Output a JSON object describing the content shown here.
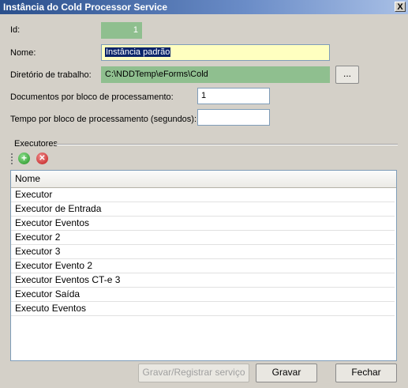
{
  "window": {
    "title": "Instância do Cold Processor Service",
    "close_label": "X"
  },
  "form": {
    "id_label": "Id:",
    "id_value": "1",
    "nome_label": "Nome:",
    "nome_value": "Instância padrão",
    "diretorio_label": "Diretório de trabalho:",
    "diretorio_value": "C:\\NDDTemp\\eForms\\Cold",
    "browse_label": "...",
    "docs_label": "Documentos por bloco de processamento:",
    "docs_value": "1",
    "tempo_label": "Tempo por bloco de processamento (segundos):",
    "tempo_value": ""
  },
  "executores": {
    "group_title": "Executores",
    "toolbar": {
      "add_icon": "add-icon",
      "remove_icon": "remove-icon"
    },
    "column_header": "Nome",
    "rows": [
      "Executor",
      "Executor de Entrada",
      "Executor Eventos",
      "Executor 2",
      "Executor 3",
      "Executor Evento 2",
      "Executor Eventos CT-e 3",
      "Executor Saída",
      "Executo Eventos"
    ]
  },
  "buttons": {
    "register_label": "Gravar/Registrar serviço",
    "save_label": "Gravar",
    "close_label": "Fechar"
  },
  "colors": {
    "titlebar_start": "#2a4f8c",
    "readonly_field": "#8fbf8f",
    "focused_field": "#ffffc0",
    "dialog_bg": "#d4d0c8"
  }
}
